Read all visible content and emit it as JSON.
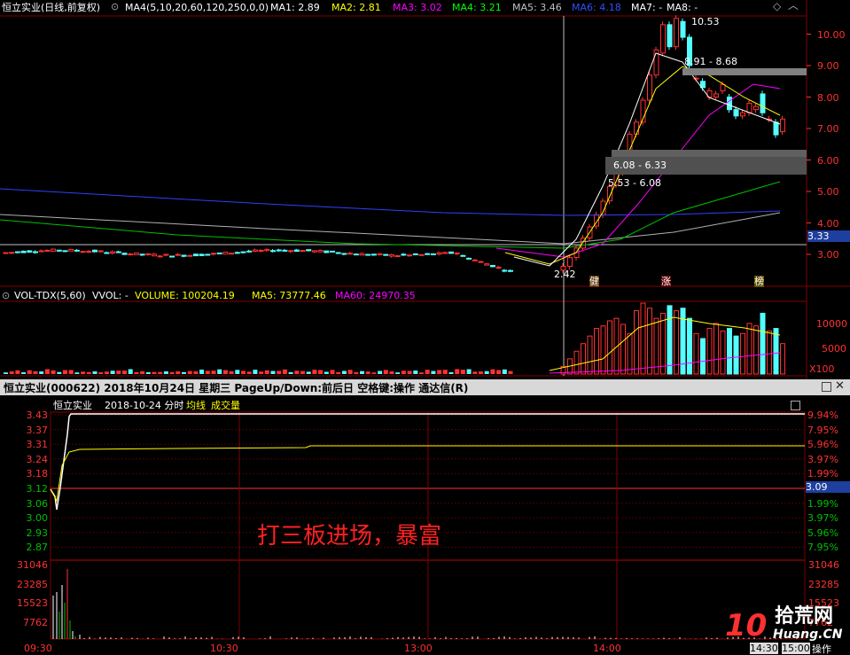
{
  "main_chart": {
    "header": {
      "title": "恒立实业(日线,前复权)",
      "ma_formula": "MA4(5,10,20,60,120,250,0,0)",
      "ma_items": [
        {
          "label": "MA1: 2.89",
          "color": "#ffffff"
        },
        {
          "label": "MA2: 2.81",
          "color": "#ffff00"
        },
        {
          "label": "MA3: 3.02",
          "color": "#ff00ff"
        },
        {
          "label": "MA4: 3.21",
          "color": "#00ff00"
        },
        {
          "label": "MA5: 3.46",
          "color": "#c0c0c0"
        },
        {
          "label": "MA6: 4.18",
          "color": "#0000ff"
        },
        {
          "label": "MA7: -",
          "color": "#ffffff"
        },
        {
          "label": "MA8: -",
          "color": "#ffffff"
        }
      ]
    },
    "price_axis": [
      "10.00",
      "9.00",
      "8.00",
      "7.00",
      "6.00",
      "5.00",
      "4.00",
      "3.00"
    ],
    "current_price": "3.33",
    "annotations": {
      "high": "10.53",
      "zone1": "8.91 - 8.68",
      "zone2": "6.08 - 6.33",
      "zone3": "5.53 - 6.08",
      "low": "2.42"
    },
    "markers": [
      "健",
      "涨",
      "榜"
    ]
  },
  "volume_chart": {
    "header": {
      "indicator": "VOL-TDX(5,60)",
      "vvol": "VVOL: -",
      "volume": "VOLUME: 100204.19",
      "ma5": "MA5: 73777.46",
      "ma60": "MA60: 24970.35"
    },
    "axis": [
      "10000",
      "5000"
    ],
    "unit": "X100"
  },
  "intraday_bar": {
    "title": "恒立实业(000622)  2018年10月24日 星期三  PageUp/Down:前后日 空格键:操作 通达信(R)"
  },
  "intraday": {
    "legend": {
      "name": "恒立实业",
      "date": "2018-10-24 分时",
      "avg_label": "均线",
      "vol_label": "成交量"
    },
    "price_left": [
      "3.43",
      "3.37",
      "3.31",
      "3.24",
      "3.18",
      "3.12",
      "3.06",
      "3.00",
      "2.93",
      "2.87"
    ],
    "pct_right": [
      "9.94%",
      "7.95%",
      "5.96%",
      "3.97%",
      "1.99%",
      "",
      "1.99%",
      "3.97%",
      "5.96%",
      "7.95%"
    ],
    "current_price": "3.09",
    "volume_left": [
      "31046",
      "23285",
      "15523",
      "7762"
    ],
    "volume_right": [
      "31046",
      "23285",
      "15523",
      "7762"
    ],
    "time_labels": [
      "09:30",
      "10:30",
      "13:00",
      "14:00"
    ],
    "overlay_text": "打三板进场，暴富",
    "bottom_right": {
      "time": "14:30",
      "time2": "15:00",
      "op": "操作"
    }
  },
  "watermark": {
    "brand": "拾荒网",
    "url": "Huang.CN",
    "number": "10"
  },
  "colors": {
    "up": "#ff3232",
    "down": "#54ffff",
    "grid": "#800000",
    "axis_text": "#ff3232"
  }
}
